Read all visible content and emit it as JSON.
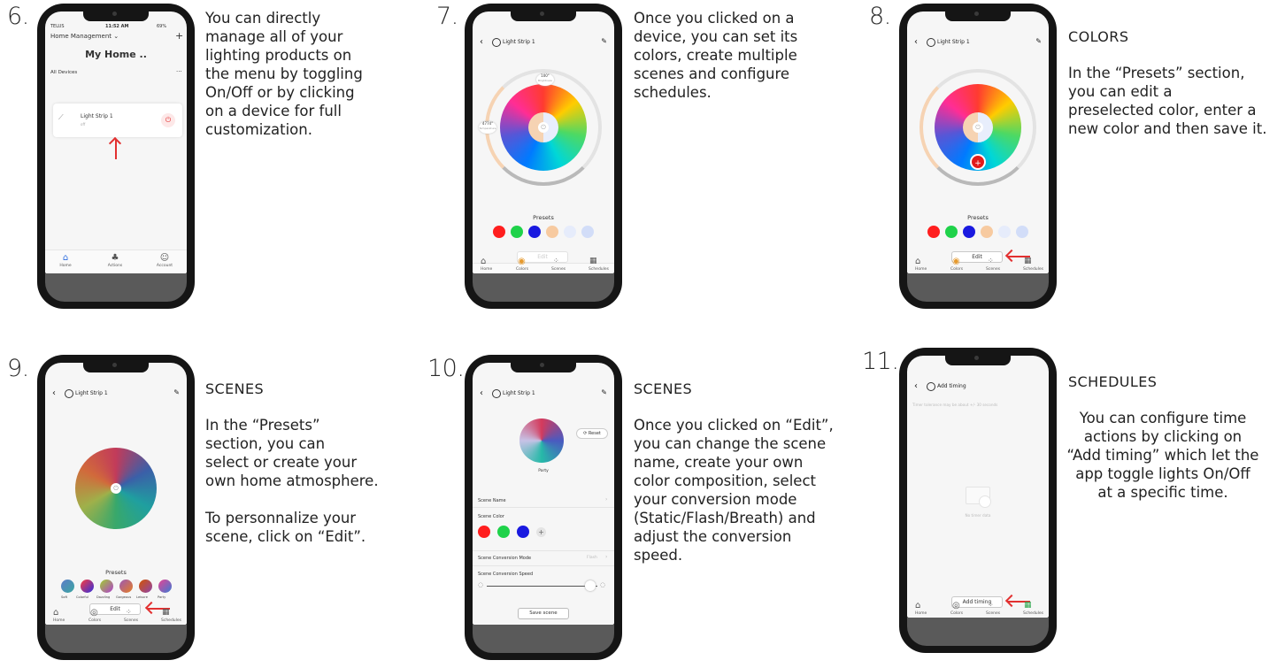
{
  "steps": [
    {
      "num": "6.",
      "text": "You can directly\nmanage all of your\nlighting products on\nthe menu by toggling\nOn/Off or by clicking\non a device for full\ncustomization."
    },
    {
      "num": "7.",
      "text": "Once you clicked on a\ndevice, you can set its\ncolors, create multiple\nscenes and configure\nschedules."
    },
    {
      "num": "8.",
      "head": "COLORS",
      "text": "In the “Presets” section,\nyou can edit a\npreselected color, enter a\nnew color and then save it."
    },
    {
      "num": "9.",
      "head": "SCENES",
      "text": "In the “Presets”\nsection, you can\nselect or create your\nown home atmosphere.\n\nTo personnalize your\nscene, click on “Edit”."
    },
    {
      "num": "10.",
      "head": "SCENES",
      "text": "Once you clicked on “Edit”,\nyou can change the scene\nname, create your own\ncolor composition, select\nyour conversion mode\n(Static/Flash/Breath) and\nadjust the conversion\nspeed."
    },
    {
      "num": "11.",
      "head": "SCHEDULES",
      "text": "You can configure time\nactions by clicking on\n“Add timing” which let the\napp toggle lights On/Off\nat a specific time."
    }
  ],
  "phone6": {
    "carrier": "TELUS",
    "time": "11:52 AM",
    "battery": "69%",
    "header": "Home Management",
    "home_title": "My Home ..",
    "all_devices": "All Devices",
    "device_name": "Light Strip 1",
    "device_status": "off",
    "tabs": [
      "Home",
      "Actions",
      "Account"
    ]
  },
  "device_screen": {
    "title": "Light Strip 1",
    "brightness": "100°",
    "brightness_label": "Brightness",
    "temperature": "4774°",
    "temperature_label": "Temperature",
    "presets_label": "Presets",
    "edit_label": "Edit",
    "tabs": [
      "Home",
      "Colors",
      "Scenes",
      "Schedules"
    ]
  },
  "colors": {
    "color_presets": [
      "#ff1e1e",
      "#1fd24a",
      "#1a1ae0",
      "#f7caa0",
      "#e6ecfb",
      "#d2ddf8"
    ],
    "accent_red": "#e23030"
  },
  "scenes": {
    "scene_names": [
      "Soft",
      "Colorful",
      "Dazzling",
      "Gorgeous",
      "Leisure",
      "Party"
    ],
    "scene_title": "Light Strip 1",
    "reset": "Reset",
    "scene_label": "Party",
    "scene_name": "Scene Name",
    "scene_color": "Scene Color",
    "conversion_mode": "Scene Conversion Mode",
    "conversion_mode_value": "Flash",
    "conversion_speed": "Scene Conversion Speed",
    "save_scene": "Save scene"
  },
  "timing": {
    "title": "Add timing",
    "tolerance": "Timer tolerance may be about +/- 30 seconds",
    "no_data": "No timer data",
    "add_timing": "Add timing"
  }
}
